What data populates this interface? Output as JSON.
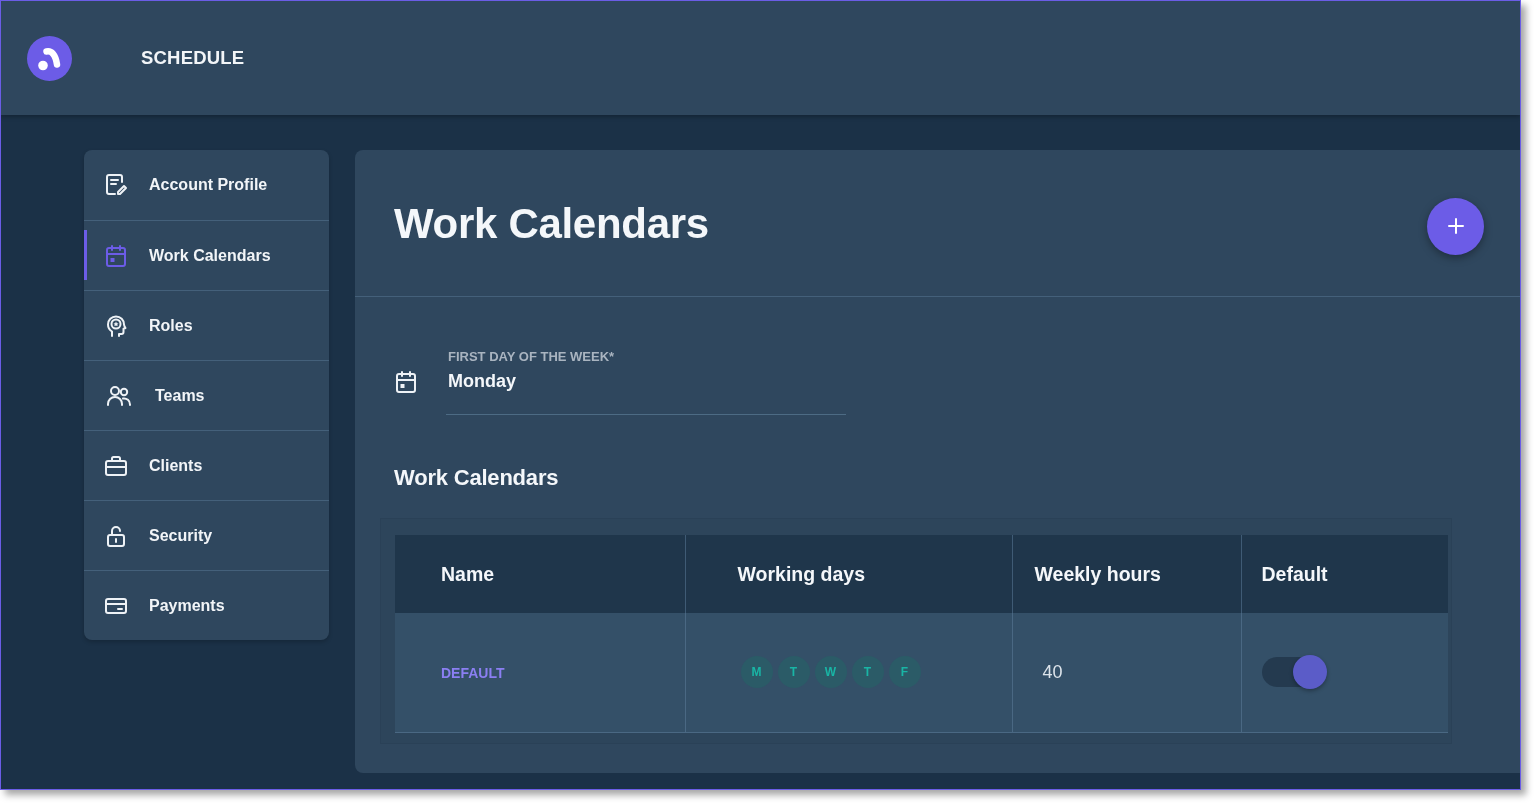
{
  "header": {
    "title": "SCHEDULE"
  },
  "sidebar": {
    "items": [
      {
        "label": "Account Profile",
        "selected": false
      },
      {
        "label": "Work Calendars",
        "selected": true
      },
      {
        "label": "Roles",
        "selected": false
      },
      {
        "label": "Teams",
        "selected": false
      },
      {
        "label": "Clients",
        "selected": false
      },
      {
        "label": "Security",
        "selected": false
      },
      {
        "label": "Payments",
        "selected": false
      }
    ]
  },
  "content": {
    "title": "Work Calendars",
    "first_day_field": {
      "label": "FIRST DAY OF THE WEEK*",
      "value": "Monday"
    },
    "section_title": "Work Calendars",
    "table": {
      "columns": [
        "Name",
        "Working days",
        "Weekly hours",
        "Default"
      ],
      "rows": [
        {
          "name": "DEFAULT",
          "working_days": [
            "M",
            "T",
            "W",
            "T",
            "F"
          ],
          "weekly_hours": "40",
          "default": true
        }
      ]
    }
  }
}
